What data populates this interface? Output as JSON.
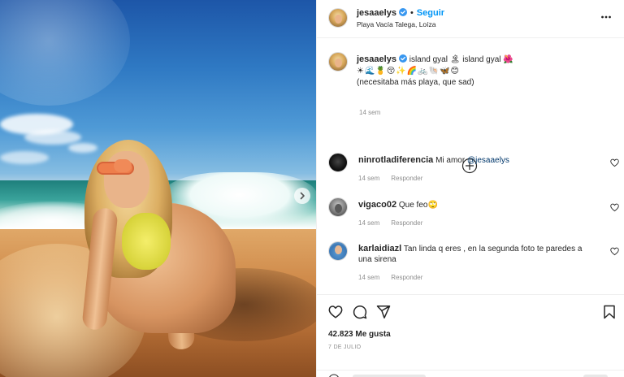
{
  "post": {
    "username": "jesaaelys",
    "follow_label": "Seguir",
    "location": "Playa Vacía Talega, Loíza",
    "caption": {
      "username": "jesaaelys",
      "text_line1": "island gyal 🏝 island gyal 🌺",
      "emoji_line": "☀🌊🍍😚✨🌈🚲🐚🦋😊",
      "text_line3": "(necesitaba más playa, que sad)",
      "time": "14 sem"
    },
    "likes": "42.823 Me gusta",
    "date": "7 DE JULIO"
  },
  "comments": [
    {
      "username": "ninrotladiferencia",
      "text": "Mi amor",
      "mention": "@jesaaelys",
      "time": "14 sem",
      "reply_label": "Responder"
    },
    {
      "username": "vigaco02",
      "text": "Que feo🙄",
      "mention": "",
      "time": "14 sem",
      "reply_label": "Responder"
    },
    {
      "username": "karlaidiazl",
      "text": "Tan linda q eres , en la segunda foto te paredes a una sirena",
      "mention": "",
      "time": "14 sem",
      "reply_label": "Responder"
    }
  ],
  "icons": {
    "verified": "verified-badge-icon",
    "more": "more-options-icon",
    "load_more": "plus-circle-icon",
    "heart": "heart-icon",
    "comment": "comment-icon",
    "share": "share-icon",
    "save": "bookmark-icon",
    "next": "chevron-right-icon"
  },
  "colors": {
    "accent": "#0095f6",
    "verified": "#3897f0",
    "mention": "#00376b",
    "muted": "#8e8e8e",
    "text": "#262626"
  }
}
